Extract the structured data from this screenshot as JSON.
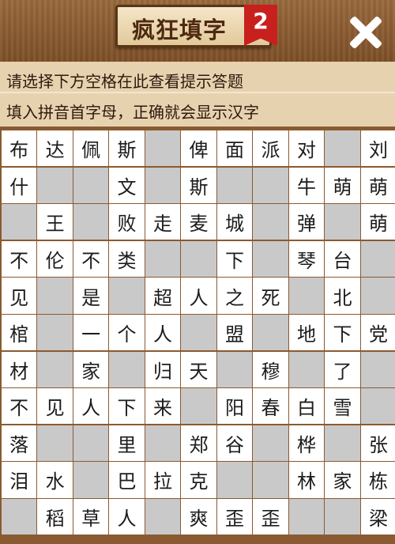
{
  "header": {
    "title": "疯狂填字",
    "level_badge": "2",
    "close_icon": "close-icon"
  },
  "hints": {
    "line1": "请选择下方空格在此查看提示答题",
    "line2": "填入拼音首字母，正确就会显示汉字"
  },
  "grid": {
    "rows": [
      [
        "布",
        "达",
        "佩",
        "斯",
        "#",
        "俾",
        "面",
        "派",
        "对",
        "#",
        "刘"
      ],
      [
        "什",
        "#",
        "#",
        "文",
        "#",
        "斯",
        "#",
        "#",
        "牛",
        "萌",
        "萌"
      ],
      [
        "#",
        "王",
        "#",
        "败",
        "走",
        "麦",
        "城",
        "#",
        "弹",
        "#",
        "萌"
      ],
      [
        "不",
        "伦",
        "不",
        "类",
        "#",
        "#",
        "下",
        "#",
        "琴",
        "台",
        "#"
      ],
      [
        "见",
        "#",
        "是",
        "#",
        "超",
        "人",
        "之",
        "死",
        "#",
        "北",
        "#"
      ],
      [
        "棺",
        "#",
        "一",
        "个",
        "人",
        "#",
        "盟",
        "#",
        "地",
        "下",
        "党"
      ],
      [
        "材",
        "#",
        "家",
        "#",
        "归",
        "天",
        "#",
        "穆",
        "#",
        "了",
        "#"
      ],
      [
        "不",
        "见",
        "人",
        "下",
        "来",
        "#",
        "阳",
        "春",
        "白",
        "雪",
        "#"
      ],
      [
        "落",
        "#",
        "#",
        "里",
        "#",
        "郑",
        "谷",
        "#",
        "桦",
        "#",
        "张"
      ],
      [
        "泪",
        "水",
        "#",
        "巴",
        "拉",
        "克",
        "#",
        "#",
        "林",
        "家",
        "栋"
      ],
      [
        "#",
        "稻",
        "草",
        "人",
        "#",
        "爽",
        "歪",
        "歪",
        "#",
        "#",
        "梁"
      ]
    ]
  },
  "colors": {
    "wood": "#8a5a32",
    "hint_bg": "#e7d2b0",
    "cell_white": "#ffffff",
    "cell_gray": "#c9c9c9",
    "badge_red": "#c8201d"
  }
}
